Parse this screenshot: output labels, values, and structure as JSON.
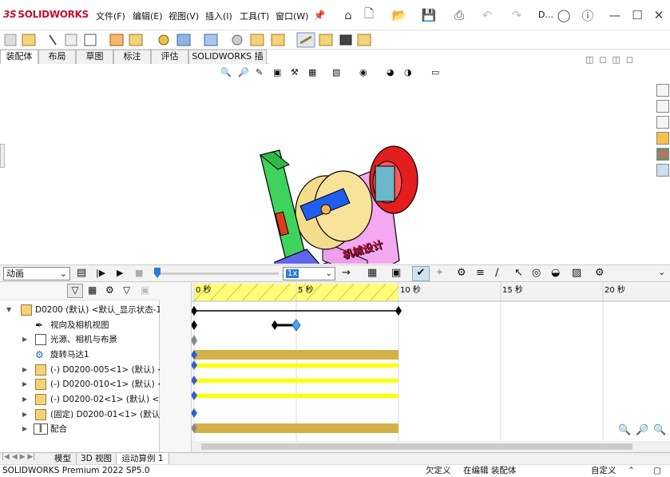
{
  "app": {
    "logo_text": "SOLIDWORKS",
    "doc_title": "D..."
  },
  "menu": [
    "文件(F)",
    "编辑(E)",
    "视图(V)",
    "插入(I)",
    "工具(T)",
    "窗口(W)"
  ],
  "command_tabs": [
    {
      "label": "装配体",
      "active": true
    },
    {
      "label": "布局",
      "active": false
    },
    {
      "label": "草图",
      "active": false
    },
    {
      "label": "标注",
      "active": false
    },
    {
      "label": "评估",
      "active": false
    },
    {
      "label": "SOLIDWORKS 插件",
      "active": false
    }
  ],
  "model_watermark": "机械设计",
  "motion": {
    "study_type": "动画",
    "playback_speed": "1x",
    "timescale_labels": [
      "0 秒",
      "5 秒",
      "10 秒",
      "15 秒",
      "20 秒"
    ],
    "tree": [
      {
        "label": "D0200 (默认) <默认_显示状态-1>",
        "has_arrow": true,
        "expanded": true
      },
      {
        "label": "视向及相机视图",
        "has_arrow": false
      },
      {
        "label": "光源、相机与布景",
        "has_arrow": true
      },
      {
        "label": "旋转马达1",
        "has_arrow": false
      },
      {
        "label": "(-) D0200-005<1> (默认) <<",
        "has_arrow": true
      },
      {
        "label": "(-) D0200-010<1> (默认) <<",
        "has_arrow": true
      },
      {
        "label": "(-) D0200-02<1> (默认) <默",
        "has_arrow": true
      },
      {
        "label": "(固定) D0200-01<1> (默认) <",
        "has_arrow": true
      },
      {
        "label": "配合",
        "has_arrow": true
      }
    ]
  },
  "bottom_tabs": [
    {
      "label": "模型",
      "active": false
    },
    {
      "label": "3D 视图",
      "active": false
    },
    {
      "label": "运动算例 1",
      "active": true
    }
  ],
  "status": {
    "product": "SOLIDWORKS Premium 2022 SP5.0",
    "constraint": "欠定义",
    "mode": "在编辑 装配体",
    "units": "自定义"
  },
  "colors": {
    "accent": "#c8102e",
    "timeline_yellow": "#ffff00",
    "timeline_gold": "#d4b04a",
    "key_blue": "#2f5fd0"
  }
}
